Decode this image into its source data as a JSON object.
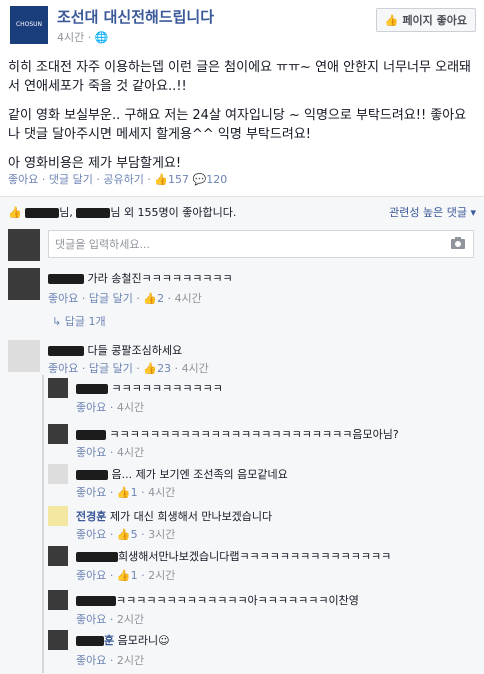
{
  "page": {
    "name": "조선대 대신전해드립니다",
    "time": "4시간",
    "like_button": "페이지 좋아요",
    "logo_text": "CHOSUN"
  },
  "post": {
    "paragraphs": [
      "히히 조대전 자주 이용하는뎁 이런 글은 첨이에요 ㅠㅠ~ 연애 안한지 너무너무 오래돼서 연애세포가 죽을 것 같아요..!!",
      "같이 영화 보실부운.. 구해요 저는 24살 여자입니당 ~ 익명으로 부탁드려요!! 좋아요 나 댓글 달아주시면 메세지 할게용^^ 익명 부탁드려요!",
      "아 영화비용은 제가 부담할게요!"
    ]
  },
  "actions": {
    "like": "좋아요",
    "comment": "댓글 달기",
    "share": "공유하기",
    "likes": "157",
    "comments": "120"
  },
  "likes_line": {
    "mid": "님,",
    "tail": "님 외 155명이 좋아합니다.",
    "sort": "관련성 높은 댓글"
  },
  "composer": {
    "placeholder": "댓글을 입력하세요..."
  },
  "comments": [
    {
      "name": "",
      "text": "가라 송철진ㅋㅋㅋㅋㅋㅋㅋㅋㅋ",
      "likes": "2",
      "time": "4시간"
    },
    {
      "reply_link": "답글 1개"
    },
    {
      "name": "",
      "text": "다들 콩팔조심하세요",
      "likes": "23",
      "time": "4시간"
    },
    {
      "name": "",
      "text": "ㅋㅋㅋㅋㅋㅋㅋㅋㅋㅋㅋ",
      "likes": "",
      "time": "4시간"
    },
    {
      "name": "",
      "text": "ㅋㅋㅋㅋㅋㅋㅋㅋㅋㅋㅋㅋㅋㅋㅋㅋㅋㅋㅋㅋㅋㅋㅋㅋ음모아님?",
      "likes": "",
      "time": "4시간"
    },
    {
      "name": "",
      "text": "음... 제가 보기엔 조선족의 음모같네요",
      "likes": "1",
      "time": "4시간"
    },
    {
      "name": "전경훈",
      "text": "제가 대신 희생해서 만나보겠습니다",
      "likes": "5",
      "time": "3시간"
    },
    {
      "name": "",
      "text": "희생해서만나보겠습니다랩ㅋㅋㅋㅋㅋㅋㅋㅋㅋㅋㅋㅋㅋㅋㅋ",
      "likes": "1",
      "time": "2시간"
    },
    {
      "name": "",
      "text": "ㅋㅋㅋㅋㅋㅋㅋㅋㅋㅋㅋㅋㅋ아ㅋㅋㅋㅋㅋㅋㅋ이찬영",
      "likes": "",
      "time": "2시간"
    },
    {
      "name": "훈",
      "text": "음모라니",
      "likes": "",
      "time": "2시간",
      "emoji": "☺"
    }
  ],
  "labels": {
    "like": "좋아요",
    "reply": "답글 달기",
    "dot": "·"
  }
}
